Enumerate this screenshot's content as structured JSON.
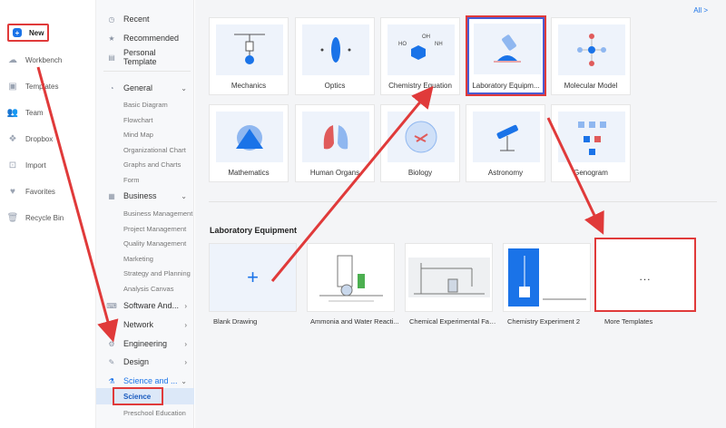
{
  "rail": {
    "items": [
      {
        "label": "New",
        "icon": "plus-icon"
      },
      {
        "label": "Workbench",
        "icon": "cloud-icon"
      },
      {
        "label": "Templates",
        "icon": "template-icon"
      },
      {
        "label": "Team",
        "icon": "team-icon"
      },
      {
        "label": "Dropbox",
        "icon": "dropbox-icon"
      },
      {
        "label": "Import",
        "icon": "import-icon"
      },
      {
        "label": "Favorites",
        "icon": "heart-icon"
      },
      {
        "label": "Recycle Bin",
        "icon": "trash-icon"
      }
    ]
  },
  "cats": {
    "top": [
      "Recent",
      "Recommended",
      "Personal Template"
    ],
    "general": {
      "label": "General",
      "subs": [
        "Basic Diagram",
        "Flowchart",
        "Mind Map",
        "Organizational Chart",
        "Graphs and Charts",
        "Form"
      ]
    },
    "business": {
      "label": "Business",
      "subs": [
        "Business Management",
        "Project Management",
        "Quality Management",
        "Marketing",
        "Strategy and Planning",
        "Analysis Canvas"
      ]
    },
    "software": "Software And...",
    "network": "Network",
    "engineering": "Engineering",
    "design": "Design",
    "science": {
      "label": "Science and ...",
      "subs": [
        "Science",
        "Preschool Education"
      ]
    }
  },
  "main": {
    "all_link": "All >",
    "cards": [
      "Mechanics",
      "Optics",
      "Chemistry Equation",
      "Laboratory Equipm...",
      "Molecular Model",
      "Mathematics",
      "Human Organs",
      "Biology",
      "Astronomy",
      "Genogram"
    ],
    "section_title": "Laboratory Equipment",
    "templates": [
      "Blank Drawing",
      "Ammonia and Water Reacti...",
      "Chemical Experimental Faci...",
      "Chemistry Experiment 2",
      "More Templates"
    ],
    "more_dots": "...",
    "chem_formula": {
      "ho": "HO",
      "oh": "OH",
      "nh": "NH"
    }
  },
  "colors": {
    "accent": "#1a73e8",
    "highlight": "#e03a3a",
    "selection": "#4a5bd1"
  }
}
